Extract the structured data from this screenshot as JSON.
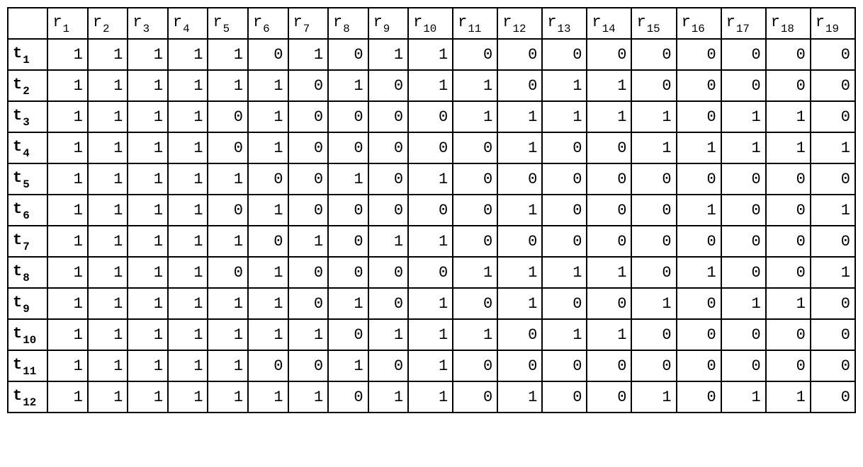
{
  "chart_data": {
    "type": "table",
    "column_prefix": "r",
    "row_prefix": "t",
    "column_subscripts": [
      1,
      2,
      3,
      4,
      5,
      6,
      7,
      8,
      9,
      10,
      11,
      12,
      13,
      14,
      15,
      16,
      17,
      18,
      19
    ],
    "row_subscripts": [
      1,
      2,
      3,
      4,
      5,
      6,
      7,
      8,
      9,
      10,
      11,
      12
    ],
    "values": [
      [
        1,
        1,
        1,
        1,
        1,
        0,
        1,
        0,
        1,
        1,
        0,
        0,
        0,
        0,
        0,
        0,
        0,
        0,
        0
      ],
      [
        1,
        1,
        1,
        1,
        1,
        1,
        0,
        1,
        0,
        1,
        1,
        0,
        1,
        1,
        0,
        0,
        0,
        0,
        0
      ],
      [
        1,
        1,
        1,
        1,
        0,
        1,
        0,
        0,
        0,
        0,
        1,
        1,
        1,
        1,
        1,
        0,
        1,
        1,
        0
      ],
      [
        1,
        1,
        1,
        1,
        0,
        1,
        0,
        0,
        0,
        0,
        0,
        1,
        0,
        0,
        1,
        1,
        1,
        1,
        1
      ],
      [
        1,
        1,
        1,
        1,
        1,
        0,
        0,
        1,
        0,
        1,
        0,
        0,
        0,
        0,
        0,
        0,
        0,
        0,
        0
      ],
      [
        1,
        1,
        1,
        1,
        0,
        1,
        0,
        0,
        0,
        0,
        0,
        1,
        0,
        0,
        0,
        1,
        0,
        0,
        1
      ],
      [
        1,
        1,
        1,
        1,
        1,
        0,
        1,
        0,
        1,
        1,
        0,
        0,
        0,
        0,
        0,
        0,
        0,
        0,
        0
      ],
      [
        1,
        1,
        1,
        1,
        0,
        1,
        0,
        0,
        0,
        0,
        1,
        1,
        1,
        1,
        0,
        1,
        0,
        0,
        1
      ],
      [
        1,
        1,
        1,
        1,
        1,
        1,
        0,
        1,
        0,
        1,
        0,
        1,
        0,
        0,
        1,
        0,
        1,
        1,
        0
      ],
      [
        1,
        1,
        1,
        1,
        1,
        1,
        1,
        0,
        1,
        1,
        1,
        0,
        1,
        1,
        0,
        0,
        0,
        0,
        0
      ],
      [
        1,
        1,
        1,
        1,
        1,
        0,
        0,
        1,
        0,
        1,
        0,
        0,
        0,
        0,
        0,
        0,
        0,
        0,
        0
      ],
      [
        1,
        1,
        1,
        1,
        1,
        1,
        1,
        0,
        1,
        1,
        0,
        1,
        0,
        0,
        1,
        0,
        1,
        1,
        0
      ]
    ]
  }
}
